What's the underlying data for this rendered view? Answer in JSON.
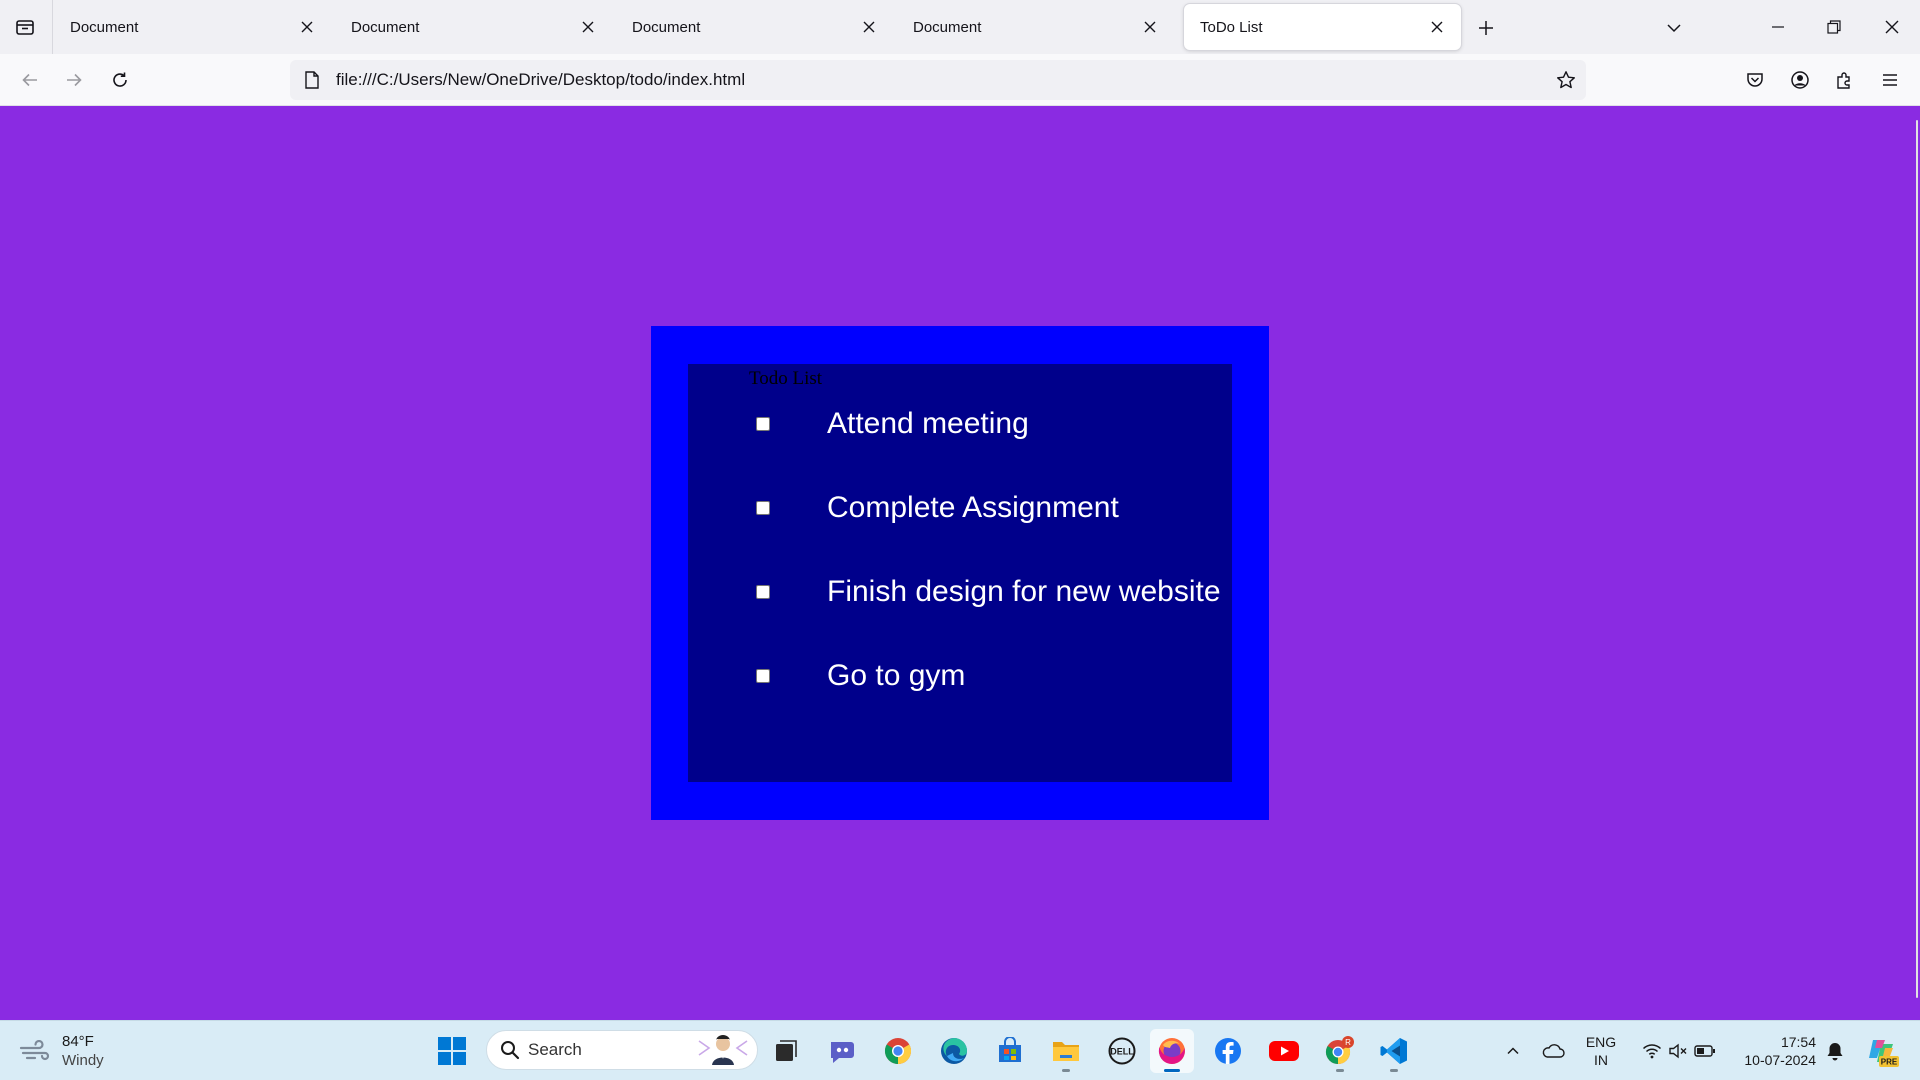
{
  "browser": {
    "tabs": [
      {
        "title": "Document",
        "active": false
      },
      {
        "title": "Document",
        "active": false
      },
      {
        "title": "Document",
        "active": false
      },
      {
        "title": "Document",
        "active": false
      },
      {
        "title": "ToDo List",
        "active": true
      }
    ],
    "url": "file:///C:/Users/New/OneDrive/Desktop/todo/index.html"
  },
  "page": {
    "background_color": "#8a2be2",
    "outer_color": "#0000ff",
    "inner_color": "#00008b",
    "title": "Todo List",
    "items": [
      {
        "label": "Attend meeting",
        "checked": false
      },
      {
        "label": "Complete Assignment",
        "checked": false
      },
      {
        "label": "Finish design for new website",
        "checked": false
      },
      {
        "label": "Go to gym",
        "checked": false
      }
    ]
  },
  "taskbar": {
    "weather": {
      "temperature": "84°F",
      "condition": "Windy"
    },
    "search_label": "Search",
    "apps": [
      "task-view-icon",
      "teams-icon",
      "chrome-icon",
      "edge-icon",
      "store-icon",
      "file-explorer-icon",
      "dell-icon",
      "firefox-icon",
      "facebook-icon",
      "youtube-icon",
      "chrome-profile-icon",
      "vscode-icon"
    ],
    "language": {
      "line1": "ENG",
      "line2": "IN"
    },
    "clock": {
      "time": "17:54",
      "date": "10-07-2024"
    },
    "copilot_badge": "PRE"
  }
}
